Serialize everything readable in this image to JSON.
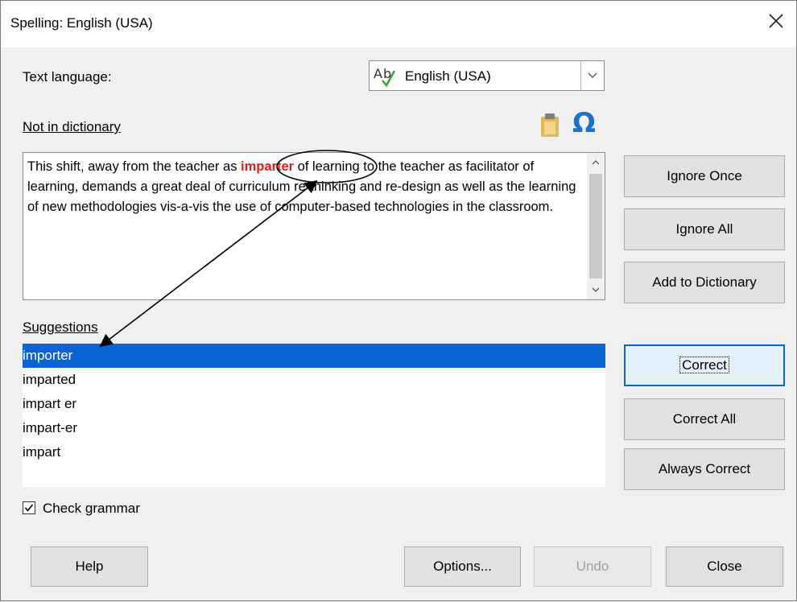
{
  "window": {
    "title": "Spelling: English (USA)"
  },
  "text_language": {
    "label": "Text language:",
    "value": "English (USA)"
  },
  "not_in_dictionary": {
    "label": "Not in dictionary",
    "text_before": "This shift, away from the teacher as ",
    "error_word": "imparter",
    "text_after": " of learning to the teacher as facilitator of learning, demands a great deal of curriculum re-thinking and re-design as well as the learning of new methodologies vis-a-vis the use of computer-based technologies in the classroom."
  },
  "icons": {
    "paste": "clipboard-icon",
    "special_char": "omega-icon",
    "omega_glyph": "Ω"
  },
  "suggestions": {
    "label": "Suggestions",
    "items": [
      "importer",
      "imparted",
      "impart er",
      "impart-er",
      "impart"
    ],
    "selected_index": 0
  },
  "buttons": {
    "ignore_once": "Ignore Once",
    "ignore_all": "Ignore All",
    "add_to_dictionary": "Add to Dictionary",
    "correct": "Correct",
    "correct_all": "Correct All",
    "always_correct": "Always Correct",
    "help": "Help",
    "options": "Options...",
    "undo": "Undo",
    "close": "Close"
  },
  "check_grammar": {
    "label": "Check grammar",
    "checked": true
  },
  "colors": {
    "selection": "#0a64d6",
    "error": "#e31b1b",
    "omega": "#1a73c6"
  }
}
